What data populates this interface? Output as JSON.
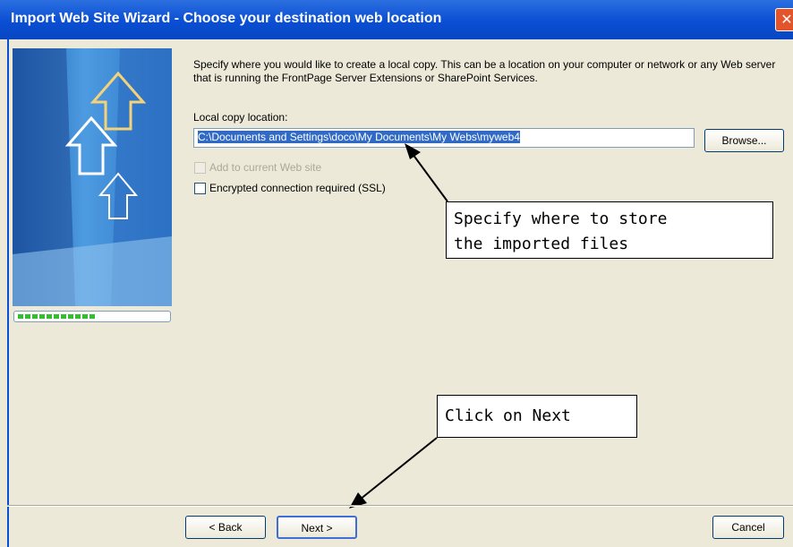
{
  "window": {
    "title": "Import Web Site Wizard - Choose your destination web location",
    "close_glyph": "✕"
  },
  "content": {
    "description": "Specify where you would like to create a local copy.  This can be a location on your computer or network or any Web server that is running the FrontPage Server Extensions or SharePoint Services.",
    "local_copy_label": "Local copy location:",
    "local_copy_value": "C:\\Documents and Settings\\doco\\My Documents\\My Webs\\myweb4",
    "browse_label": "Browse...",
    "add_to_current_label": "Add to current Web site",
    "encrypted_label": "Encrypted connection required (SSL)"
  },
  "progress": {
    "fraction": 0.55
  },
  "annotations": {
    "store_line1": "Specify where to store",
    "store_line2": "the imported files",
    "next_note": "Click on Next"
  },
  "footer": {
    "back_label": "< Back",
    "next_label": "Next >",
    "cancel_label": "Cancel"
  },
  "colors": {
    "titlebar": "#0a4ed4",
    "selection": "#316ac5",
    "progress": "#2fbf2f"
  }
}
